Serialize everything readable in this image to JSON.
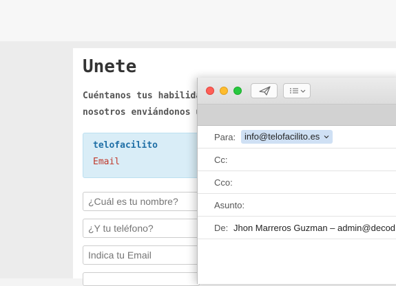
{
  "page": {
    "title": "Unete",
    "intro_line1": "Cuéntanos tus habilida",
    "intro_line2": "nosotros enviándonos u",
    "info_box": {
      "brand": "telofacilito",
      "email_label": "Email"
    },
    "form": {
      "name_placeholder": "¿Cuál es tu nombre?",
      "phone_placeholder": "¿Y tu teléfono?",
      "email_placeholder": "Indica tu Email"
    }
  },
  "mail_window": {
    "traffic_lights": {
      "close": "#ff5f57",
      "minimize": "#febc2e",
      "zoom": "#28c840"
    },
    "toolbar": {
      "send_icon": "paper-plane-icon",
      "format_icon": "list-icon"
    },
    "fields": {
      "to_label": "Para:",
      "to_value": "info@telofacilito.es",
      "cc_label": "Cc:",
      "bcc_label": "Cco:",
      "subject_label": "Asunto:",
      "from_label": "De:",
      "from_value": "Jhon Marreros Guzman – admin@decod"
    }
  }
}
